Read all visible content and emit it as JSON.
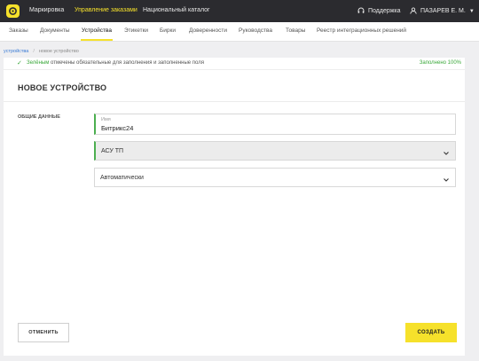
{
  "topbar": {
    "nav": [
      {
        "label": "Маркировка"
      },
      {
        "label": "Управление заказами"
      },
      {
        "label": "Национальный каталог"
      }
    ],
    "support_label": "Поддержка",
    "user_label": "ПАЗАРЕВ Е. М."
  },
  "subnav": {
    "items": [
      {
        "label": "Заказы"
      },
      {
        "label": "Документы"
      },
      {
        "label": "Устройства"
      },
      {
        "label": "Этикетки"
      },
      {
        "label": "Бирки"
      },
      {
        "label": "Доверенности"
      },
      {
        "label": "Руководства"
      },
      {
        "label": "Товары"
      },
      {
        "label": "Реестр интеграционных решений"
      }
    ]
  },
  "breadcrumb": {
    "parent": "устройства",
    "separator": "/",
    "current": "новое устройство"
  },
  "notice": {
    "highlight": "Зелёным",
    "text": " отмечены обязательные для заполнения и заполненные поля",
    "progress": "Заполнено 100%"
  },
  "form": {
    "title": "НОВОЕ УСТРОЙСТВО",
    "section_label": "ОБЩИЕ ДАННЫЕ",
    "name_label": "Имя",
    "name_value": "Битрикс24",
    "type_value": "АСУ ТП",
    "mode_value": "Автоматически"
  },
  "actions": {
    "cancel_label": "ОТМЕНИТЬ",
    "create_label": "СОЗДАТЬ"
  },
  "colors": {
    "accent": "#f6e12b",
    "success": "#4caf50",
    "topbar": "#2b2b2f"
  }
}
